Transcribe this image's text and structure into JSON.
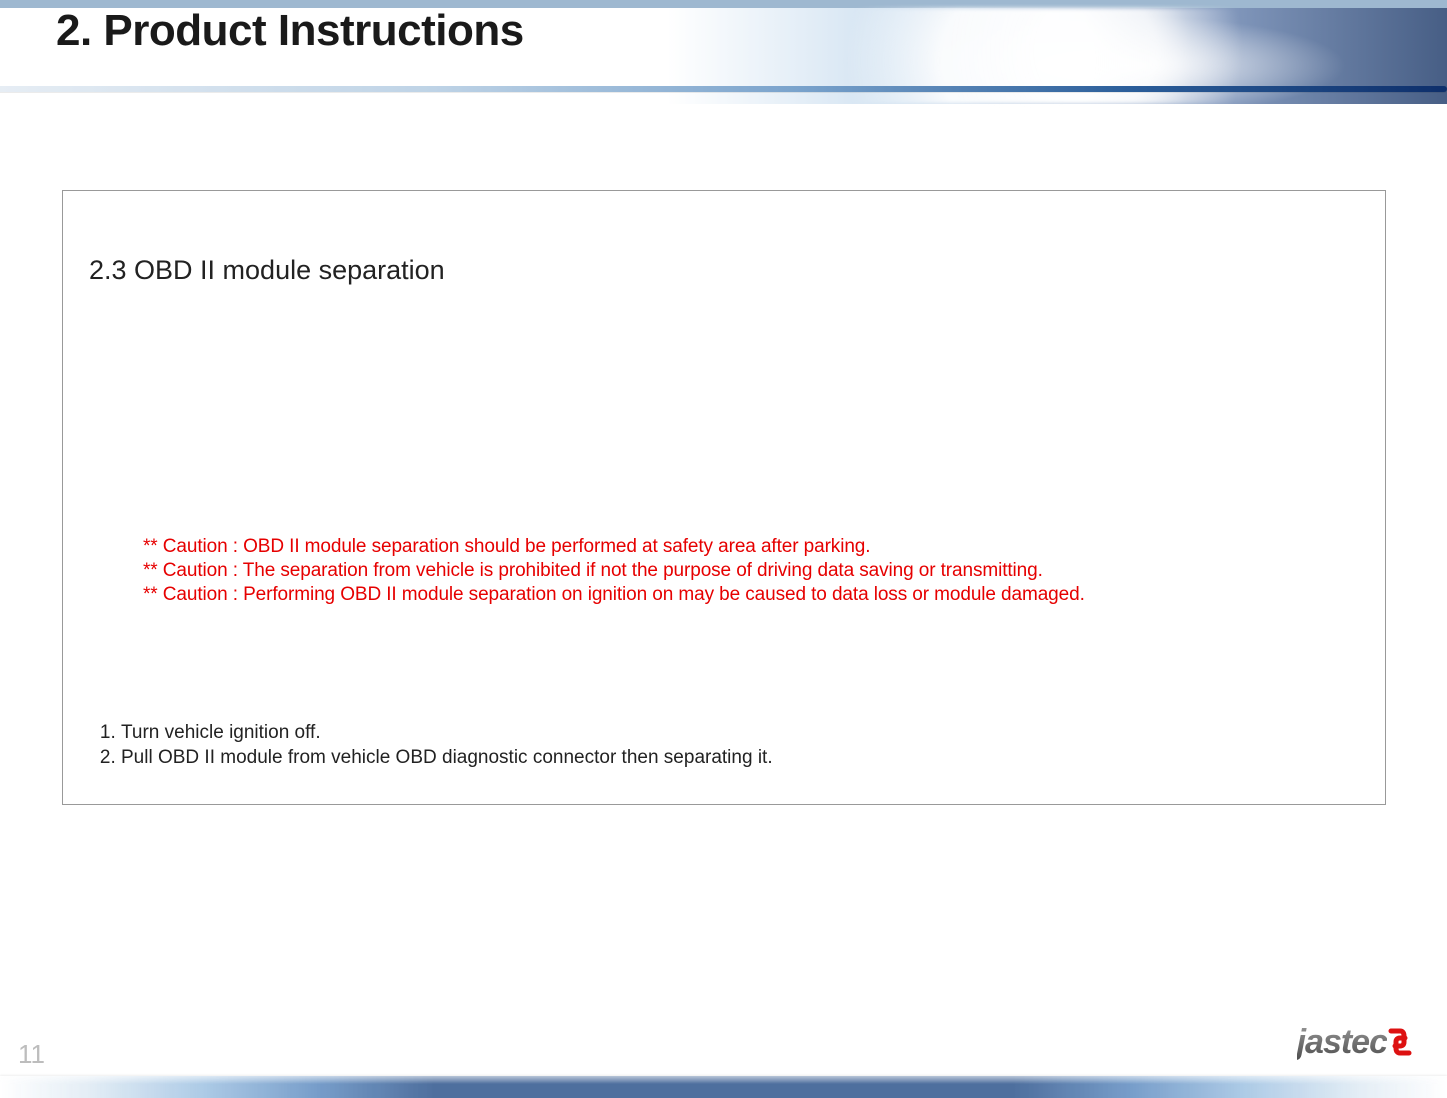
{
  "header": {
    "title": "2. Product Instructions"
  },
  "section": {
    "title": "2.3 OBD II module separation"
  },
  "cautions": [
    "** Caution : OBD II module separation should be performed at safety area after parking.",
    "** Caution : The separation from vehicle is prohibited if not the purpose of driving data saving or transmitting.",
    "** Caution : Performing OBD II module separation on ignition on may be caused to data loss or module damaged."
  ],
  "steps": [
    "Turn vehicle ignition off.",
    "Pull OBD II module from vehicle OBD diagnostic connector then separating it."
  ],
  "page_number": "11",
  "brand": {
    "name": "jastec"
  }
}
